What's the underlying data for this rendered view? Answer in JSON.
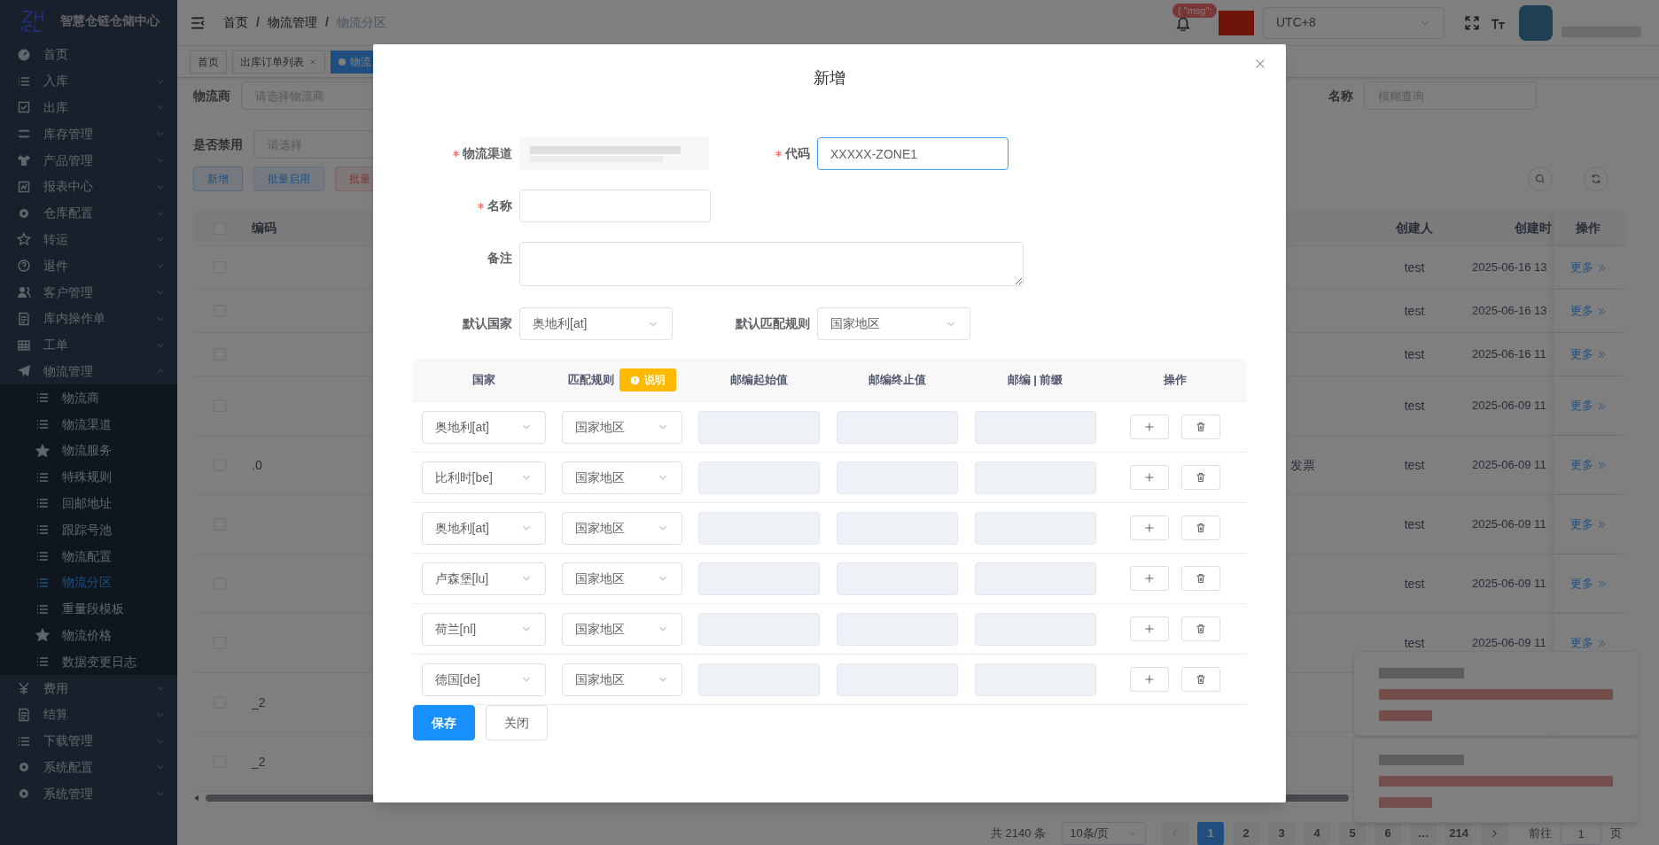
{
  "sidebar": {
    "logo_text": "智慧仓链仓储中心",
    "items": [
      {
        "label": "首页",
        "kind": "link",
        "selected": false
      },
      {
        "label": "入库",
        "kind": "group",
        "selected": false,
        "expanded": false
      },
      {
        "label": "出库",
        "kind": "group",
        "selected": false,
        "expanded": false
      },
      {
        "label": "库存管理",
        "kind": "group",
        "selected": false,
        "expanded": false
      },
      {
        "label": "产品管理",
        "kind": "group",
        "selected": false,
        "expanded": false
      },
      {
        "label": "报表中心",
        "kind": "group",
        "selected": false,
        "expanded": false
      },
      {
        "label": "仓库配置",
        "kind": "group",
        "selected": false,
        "expanded": false
      },
      {
        "label": "转运",
        "kind": "group",
        "selected": false,
        "expanded": false
      },
      {
        "label": "退件",
        "kind": "group",
        "selected": false,
        "expanded": false
      },
      {
        "label": "客户管理",
        "kind": "group",
        "selected": false,
        "expanded": false
      },
      {
        "label": "库内操作单",
        "kind": "group",
        "selected": false,
        "expanded": false
      },
      {
        "label": "工单",
        "kind": "group",
        "selected": false,
        "expanded": false
      },
      {
        "label": "物流管理",
        "kind": "group",
        "selected": false,
        "expanded": true,
        "children": [
          {
            "label": "物流商",
            "selected": false
          },
          {
            "label": "物流渠道",
            "selected": false
          },
          {
            "label": "物流服务",
            "selected": false
          },
          {
            "label": "特殊规则",
            "selected": false
          },
          {
            "label": "回邮地址",
            "selected": false
          },
          {
            "label": "跟踪号池",
            "selected": false
          },
          {
            "label": "物流配置",
            "selected": false
          },
          {
            "label": "物流分区",
            "selected": true
          },
          {
            "label": "重量段模板",
            "selected": false
          },
          {
            "label": "物流价格",
            "selected": false
          },
          {
            "label": "数据变更日志",
            "selected": false
          }
        ]
      },
      {
        "label": "费用",
        "kind": "group",
        "selected": false,
        "expanded": false
      },
      {
        "label": "结算",
        "kind": "group",
        "selected": false,
        "expanded": false
      },
      {
        "label": "下载管理",
        "kind": "group",
        "selected": false,
        "expanded": false
      },
      {
        "label": "系统配置",
        "kind": "group",
        "selected": false,
        "expanded": false
      },
      {
        "label": "系统管理",
        "kind": "group",
        "selected": false,
        "expanded": false
      }
    ]
  },
  "header": {
    "breadcrumb": [
      "首页",
      "物流管理",
      "物流分区"
    ],
    "breadcrumb_separator": "/",
    "notice_badge": "{ \"msg\":",
    "timezone": "UTC+8"
  },
  "tags": [
    {
      "label": "首页",
      "selected": false,
      "closable": false
    },
    {
      "label": "出库订单列表",
      "selected": false,
      "closable": true
    },
    {
      "label": "物流",
      "selected": true,
      "closable": false
    }
  ],
  "filters": [
    {
      "label": "物流商",
      "placeholder": "请选择物流商"
    },
    {
      "label": "名称",
      "placeholder": "模糊查询"
    },
    {
      "label": "是否禁用",
      "placeholder": "请选择"
    }
  ],
  "toolbar_buttons": [
    {
      "label": "新增",
      "kind": "primary"
    },
    {
      "label": "批量启用",
      "kind": "success"
    },
    {
      "label": "批量",
      "kind": "danger"
    }
  ],
  "table": {
    "columns": [
      "编码",
      "创建人",
      "创建时",
      "操作"
    ],
    "all_checked": false,
    "rows": [
      {
        "checked": false,
        "creator": "test",
        "created": "2025-06-16 13",
        "action": "更多"
      },
      {
        "checked": false,
        "creator": "test",
        "created": "2025-06-16 13",
        "action": "更多"
      },
      {
        "checked": false,
        "creator": "test",
        "created": "2025-06-16 11",
        "action": "更多"
      },
      {
        "checked": false,
        "creator": "test",
        "created": "2025-06-09 11",
        "action": "更多"
      },
      {
        "checked": false,
        "code_suffix": ".0",
        "remark": "发票",
        "creator": "test",
        "created": "2025-06-09 11",
        "action": "更多"
      },
      {
        "checked": false,
        "creator": "test",
        "created": "2025-06-09 11",
        "action": "更多"
      },
      {
        "checked": false,
        "creator": "test",
        "created": "2025-06-09 11",
        "action": "更多"
      },
      {
        "checked": false,
        "creator": "test",
        "created": "2025-06-09 11",
        "action": "更多"
      },
      {
        "checked": false,
        "code_suffix": "_2"
      },
      {
        "checked": false,
        "code_suffix": "_2"
      }
    ]
  },
  "pagination": {
    "total": "共 2140 条",
    "page_size": "10条/页",
    "pages": [
      {
        "label": "1",
        "selected": true
      },
      {
        "label": "2",
        "selected": false
      },
      {
        "label": "3",
        "selected": false
      },
      {
        "label": "4",
        "selected": false
      },
      {
        "label": "5",
        "selected": false
      },
      {
        "label": "6",
        "selected": false
      },
      {
        "label": "…",
        "selected": false
      },
      {
        "label": "214",
        "selected": false
      }
    ],
    "goto_label": "前往",
    "goto_value": "1",
    "page_unit": "页"
  },
  "dialog": {
    "title": "新增",
    "channel": {
      "label": "物流渠道",
      "required": true
    },
    "code": {
      "label": "代码",
      "required": true,
      "value": "XXXXX-ZONE1",
      "focused": true
    },
    "name": {
      "label": "名称",
      "required": true
    },
    "remark": {
      "label": "备注"
    },
    "default_country": {
      "label": "默认国家",
      "value": "奥地利[at]"
    },
    "default_rule": {
      "label": "默认匹配规则",
      "value": "国家地区"
    },
    "zone_table": {
      "columns": [
        {
          "label": "国家"
        },
        {
          "label": "匹配规则",
          "badge": "说明"
        },
        {
          "label": "邮编起始值"
        },
        {
          "label": "邮编终止值"
        },
        {
          "label": "邮编 | 前缀"
        },
        {
          "label": "操作"
        }
      ],
      "rows": [
        {
          "country": "奥地利[at]",
          "rule": "国家地区",
          "zip_disabled": true
        },
        {
          "country": "比利时[be]",
          "rule": "国家地区",
          "zip_disabled": true
        },
        {
          "country": "奥地利[at]",
          "rule": "国家地区",
          "zip_disabled": true
        },
        {
          "country": "卢森堡[lu]",
          "rule": "国家地区",
          "zip_disabled": true
        },
        {
          "country": "荷兰[nl]",
          "rule": "国家地区",
          "zip_disabled": true
        },
        {
          "country": "德国[de]",
          "rule": "国家地区",
          "zip_disabled": true
        }
      ]
    },
    "buttons": [
      {
        "label": "保存",
        "kind": "primary"
      },
      {
        "label": "关闭",
        "kind": "default"
      }
    ]
  }
}
